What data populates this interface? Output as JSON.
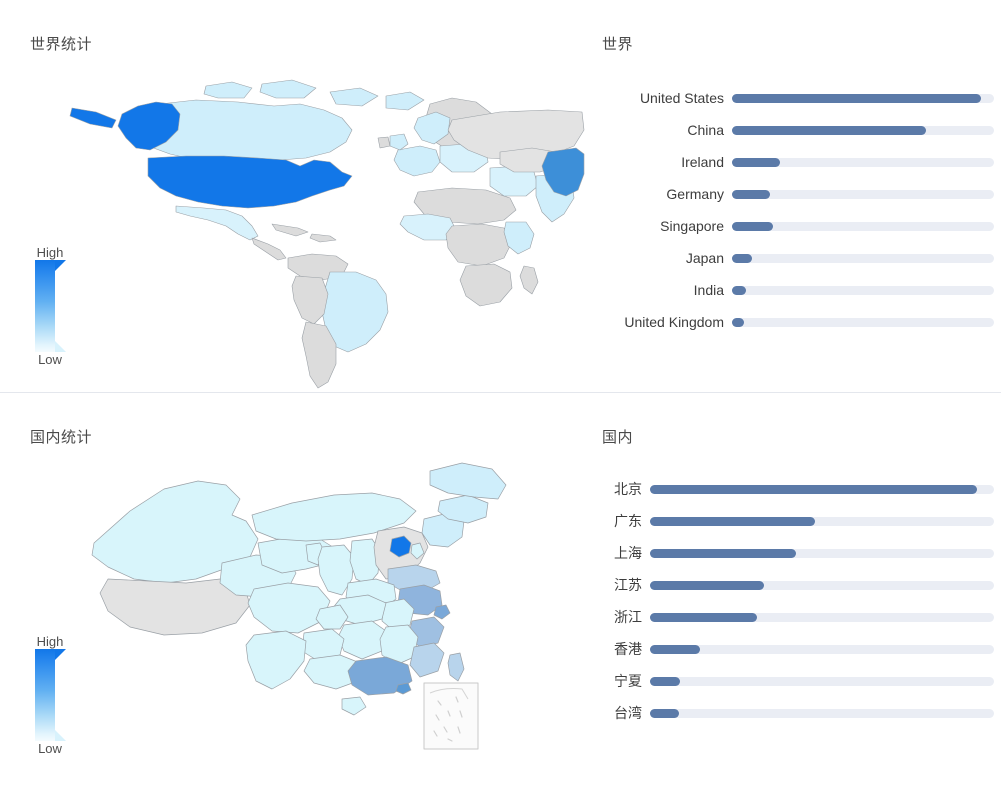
{
  "world_section": {
    "map_title": "世界统计",
    "rank_title": "世界",
    "legend": {
      "high": "High",
      "low": "Low"
    },
    "ranking": [
      {
        "label": "United States",
        "percent": 95.0
      },
      {
        "label": "China",
        "percent": 74.0
      },
      {
        "label": "Ireland",
        "percent": 18.5
      },
      {
        "label": "Germany",
        "percent": 14.5
      },
      {
        "label": "Singapore",
        "percent": 15.5
      },
      {
        "label": "Japan",
        "percent": 7.5
      },
      {
        "label": "India",
        "percent": 5.5
      },
      {
        "label": "United Kingdom",
        "percent": 4.5
      }
    ]
  },
  "domestic_section": {
    "map_title": "国内统计",
    "rank_title": "国内",
    "legend": {
      "high": "High",
      "low": "Low"
    },
    "ranking": [
      {
        "label": "北京",
        "percent": 95.0
      },
      {
        "label": "广东",
        "percent": 48.0
      },
      {
        "label": "上海",
        "percent": 42.5
      },
      {
        "label": "江苏",
        "percent": 33.0
      },
      {
        "label": "浙江",
        "percent": 31.0
      },
      {
        "label": "香港",
        "percent": 14.5
      },
      {
        "label": "宁夏",
        "percent": 8.8
      },
      {
        "label": "台湾",
        "percent": 8.3
      }
    ]
  },
  "chart_data": [
    {
      "type": "bar",
      "title": "世界",
      "orientation": "horizontal",
      "categories": [
        "United States",
        "China",
        "Ireland",
        "Germany",
        "Singapore",
        "Japan",
        "India",
        "United Kingdom"
      ],
      "values": [
        95.0,
        74.0,
        18.5,
        14.5,
        15.5,
        7.5,
        5.5,
        4.5
      ],
      "xlabel": "",
      "ylabel": "",
      "xlim": [
        0,
        100
      ],
      "grid": false,
      "legend": "none",
      "bar_color": "#5b7aa8",
      "track_color": "#eaedf4"
    },
    {
      "type": "bar",
      "title": "国内",
      "orientation": "horizontal",
      "categories": [
        "北京",
        "广东",
        "上海",
        "江苏",
        "浙江",
        "香港",
        "宁夏",
        "台湾"
      ],
      "values": [
        95.0,
        48.0,
        42.5,
        33.0,
        31.0,
        14.5,
        8.8,
        8.3
      ],
      "xlabel": "",
      "ylabel": "",
      "xlim": [
        0,
        100
      ],
      "grid": false,
      "legend": "none",
      "bar_color": "#5b7aa8",
      "track_color": "#eaedf4"
    },
    {
      "type": "heatmap",
      "title": "世界统计",
      "subtype": "choropleth-world",
      "legend_high": "High",
      "legend_low": "Low",
      "color_scale": [
        "#f4fbfe",
        "#1277e8"
      ],
      "no_data_color": "#dcdcdc",
      "highlights": [
        {
          "region": "United States",
          "level": "high"
        },
        {
          "region": "China",
          "level": "high"
        },
        {
          "region": "Canada",
          "level": "low"
        },
        {
          "region": "Australia",
          "level": "low"
        },
        {
          "region": "India",
          "level": "low"
        },
        {
          "region": "Brazil",
          "level": "low"
        }
      ]
    },
    {
      "type": "heatmap",
      "title": "国内统计",
      "subtype": "choropleth-china",
      "legend_high": "High",
      "legend_low": "Low",
      "color_scale": [
        "#f4fbfe",
        "#1277e8"
      ],
      "no_data_color": "#e3e3e3",
      "highlights": [
        {
          "region": "北京",
          "level": "high"
        },
        {
          "region": "广东",
          "level": "medium"
        },
        {
          "region": "上海",
          "level": "medium"
        },
        {
          "region": "江苏",
          "level": "medium"
        },
        {
          "region": "浙江",
          "level": "medium"
        }
      ]
    }
  ]
}
